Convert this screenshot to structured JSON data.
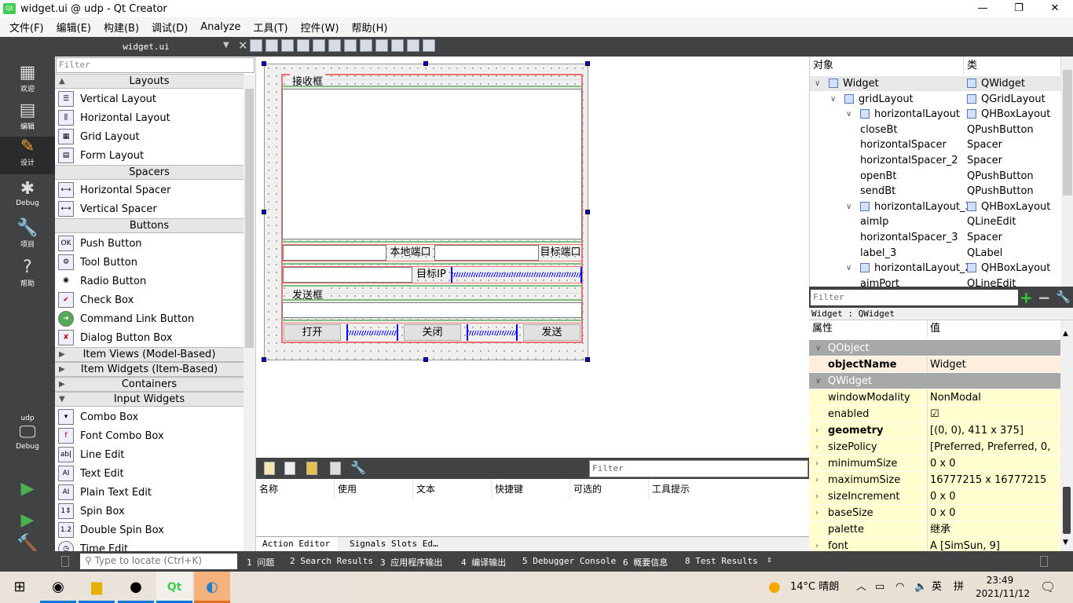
{
  "window": {
    "title": "widget.ui @ udp - Qt Creator",
    "logo": "Qt"
  },
  "menu": [
    "文件(F)",
    "编辑(E)",
    "构建(B)",
    "调试(D)",
    "Analyze",
    "工具(T)",
    "控件(W)",
    "帮助(H)"
  ],
  "editor_tab": "widget.ui",
  "modes": [
    {
      "label": "欢迎",
      "icon": "grid-icon"
    },
    {
      "label": "编辑",
      "icon": "document-icon"
    },
    {
      "label": "设计",
      "icon": "pencil-icon"
    },
    {
      "label": "Debug",
      "icon": "bug-icon"
    },
    {
      "label": "项目",
      "icon": "wrench-icon"
    },
    {
      "label": "帮助",
      "icon": "help-icon"
    }
  ],
  "kit": {
    "project": "udp",
    "config": "Debug"
  },
  "widgetbox": {
    "filter_placeholder": "Filter",
    "categories": [
      "Layouts",
      "Spacers",
      "Buttons",
      "Item Views (Model-Based)",
      "Item Widgets (Item-Based)",
      "Containers",
      "Input Widgets"
    ],
    "layouts": [
      "Vertical Layout",
      "Horizontal Layout",
      "Grid Layout",
      "Form Layout"
    ],
    "spacers": [
      "Horizontal Spacer",
      "Vertical Spacer"
    ],
    "buttons": [
      "Push Button",
      "Tool Button",
      "Radio Button",
      "Check Box",
      "Command Link Button",
      "Dialog Button Box"
    ],
    "inputs": [
      "Combo Box",
      "Font Combo Box",
      "Line Edit",
      "Text Edit",
      "Plain Text Edit",
      "Spin Box",
      "Double Spin Box",
      "Time Edit"
    ]
  },
  "form": {
    "recv_group": "接收框",
    "local_port_label": "本地端口",
    "target_port_label": "目标端口",
    "target_ip_label": "目标IP",
    "send_group": "发送框",
    "open_btn": "打开",
    "close_btn": "关闭",
    "send_btn": "发送"
  },
  "action_editor": {
    "filter_placeholder": "Filter",
    "columns": [
      "名称",
      "使用",
      "文本",
      "快捷键",
      "可选的",
      "工具提示"
    ],
    "tabs": [
      "Action Editor",
      "Signals  Slots Ed…"
    ]
  },
  "object_inspector": {
    "headers": [
      "对象",
      "类"
    ],
    "rows": [
      {
        "name": "Widget",
        "class": "QWidget",
        "level": 0,
        "expand": true
      },
      {
        "name": "gridLayout",
        "class": "QGridLayout",
        "level": 1,
        "expand": true
      },
      {
        "name": "horizontalLayout",
        "class": "QHBoxLayout",
        "level": 2,
        "expand": true
      },
      {
        "name": "closeBt",
        "class": "QPushButton",
        "level": 3
      },
      {
        "name": "horizontalSpacer",
        "class": "Spacer",
        "level": 3
      },
      {
        "name": "horizontalSpacer_2",
        "class": "Spacer",
        "level": 3
      },
      {
        "name": "openBt",
        "class": "QPushButton",
        "level": 3
      },
      {
        "name": "sendBt",
        "class": "QPushButton",
        "level": 3
      },
      {
        "name": "horizontalLayout_3",
        "class": "QHBoxLayout",
        "level": 2,
        "expand": true
      },
      {
        "name": "aimIp",
        "class": "QLineEdit",
        "level": 3
      },
      {
        "name": "horizontalSpacer_3",
        "class": "Spacer",
        "level": 3
      },
      {
        "name": "label_3",
        "class": "QLabel",
        "level": 3
      },
      {
        "name": "horizontalLayout_2",
        "class": "QHBoxLayout",
        "level": 2,
        "expand": true
      },
      {
        "name": "aimPort",
        "class": "QLineEdit",
        "level": 3
      }
    ]
  },
  "property_editor": {
    "filter_placeholder": "Filter",
    "class_line": "Widget : QWidget",
    "headers": [
      "属性",
      "值"
    ],
    "rows": [
      {
        "key": "QObject",
        "value": "",
        "type": "group"
      },
      {
        "key": "objectName",
        "value": "Widget",
        "type": "bold"
      },
      {
        "key": "QWidget",
        "value": "",
        "type": "group"
      },
      {
        "key": "windowModality",
        "value": "NonModal"
      },
      {
        "key": "enabled",
        "value": "☑"
      },
      {
        "key": "geometry",
        "value": "[(0, 0), 411 x 375]",
        "type": "boldexp"
      },
      {
        "key": "sizePolicy",
        "value": "[Preferred, Preferred, 0, 0]",
        "type": "exp"
      },
      {
        "key": "minimumSize",
        "value": "0 x 0",
        "type": "exp"
      },
      {
        "key": "maximumSize",
        "value": "16777215 x 16777215",
        "type": "exp"
      },
      {
        "key": "sizeIncrement",
        "value": "0 x 0",
        "type": "exp"
      },
      {
        "key": "baseSize",
        "value": "0 x 0",
        "type": "exp"
      },
      {
        "key": "palette",
        "value": "继承"
      },
      {
        "key": "font",
        "value": "A  [SimSun, 9]",
        "type": "exp"
      }
    ]
  },
  "output_bar": {
    "locator_placeholder": "Type to locate (Ctrl+K)",
    "panes": [
      "1 问题",
      "2 Search Results",
      "3 应用程序输出",
      "4 编译输出",
      "5 Debugger Console",
      "6 概要信息",
      "8 Test Results"
    ]
  },
  "taskbar": {
    "weather": "14°C 晴朗",
    "ime": "英",
    "ime2": "拼",
    "time": "23:49",
    "date": "2021/11/12"
  }
}
